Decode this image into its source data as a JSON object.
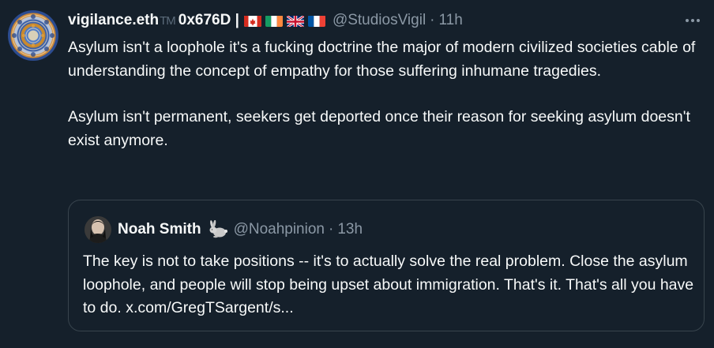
{
  "tweet": {
    "display_name": "vigilance.eth",
    "tm_mark": "TM",
    "name_suffix": "0x676D |",
    "flags": [
      "canada-flag",
      "ireland-flag",
      "uk-flag",
      "france-flag"
    ],
    "handle": "@StudiosVigil",
    "separator": "·",
    "time": "11h",
    "paragraphs": [
      "Asylum isn't a loophole it's a fucking doctrine the major of modern civilized societies cable of understanding the concept of empathy for those suffering inhumane tragedies.",
      "Asylum isn't permanent, seekers get deported once their reason for seeking asylum doesn't exist anymore."
    ],
    "more_icon": "more-horizontal-icon"
  },
  "quoted": {
    "display_name": "Noah Smith",
    "badge_icon": "rabbit-icon",
    "handle": "@Noahpinion",
    "separator": "·",
    "time": "13h",
    "text": "The key is not to take positions -- it's to actually solve the real problem. Close the asylum loophole, and people will stop being upset about immigration. That's it. That's all you have to do. x.com/GregTSargent/s..."
  },
  "colors": {
    "background": "#15202b",
    "text": "#f7f9f9",
    "secondary_text": "#8b98a5",
    "border": "#38444d"
  }
}
